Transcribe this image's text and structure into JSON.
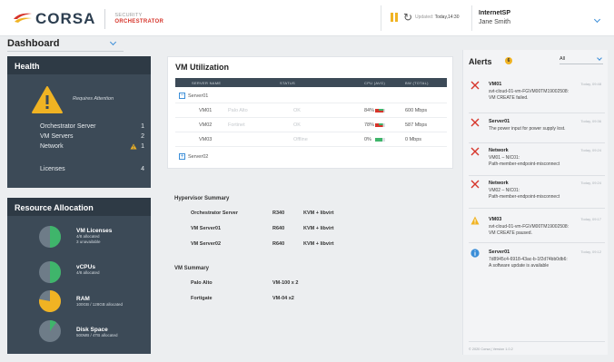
{
  "header": {
    "brand": "CORSA",
    "product_line1": "SECURITY",
    "product_line2": "ORCHESTRATOR",
    "updated_label": "Updated:",
    "updated_value": "Today,14:30",
    "tenant": "InternetSP",
    "user": "Jane Smith"
  },
  "dashboard": {
    "label": "Dashboard"
  },
  "health": {
    "title": "Health",
    "status": "Requires Attention",
    "rows": [
      {
        "label": "Orchestrator Server",
        "value": "1",
        "warn": false
      },
      {
        "label": "VM Servers",
        "value": "2",
        "warn": false
      },
      {
        "label": "Network",
        "value": "1",
        "warn": true
      },
      {
        "label": "Licenses",
        "value": "4",
        "warn": false
      }
    ]
  },
  "resource": {
    "title": "Resource Allocation",
    "items": [
      {
        "name": "VM Licenses",
        "sub1": "4/8 allocated",
        "sub2": "3 unavailable",
        "fraction": 0.5,
        "color": "#3fb56b"
      },
      {
        "name": "vCPUs",
        "sub1": "4/8 allocated",
        "sub2": "",
        "fraction": 0.5,
        "color": "#3fb56b"
      },
      {
        "name": "RAM",
        "sub1": "100GB / 128GB allocated",
        "sub2": "",
        "fraction": 0.78,
        "color": "#f0b323"
      },
      {
        "name": "Disk Space",
        "sub1": "500MB / 4TB allocated",
        "sub2": "",
        "fraction": 0.1,
        "color": "#3fb56b"
      }
    ]
  },
  "vm_util": {
    "title": "VM Utilization",
    "columns": [
      "SERVER NAME",
      "STATUS",
      "CPU (AVG)",
      "BW (TOTAL)"
    ],
    "server1": "Server01",
    "server2": "Server02",
    "rows": [
      {
        "vm": "VM01",
        "vendor": "Palo Alto",
        "status": "OK",
        "cpu": "84%",
        "bw": "600 Mbps"
      },
      {
        "vm": "VM02",
        "vendor": "Fortinet",
        "status": "OK",
        "cpu": "78%",
        "bw": "587 Mbps"
      },
      {
        "vm": "VM03",
        "vendor": "",
        "status": "Offline",
        "cpu": "0%",
        "bw": "0   Mbps"
      }
    ]
  },
  "hypervisor": {
    "title": "Hypervisor Summary",
    "rows": [
      {
        "name": "Orchestrator Server",
        "model": "R340",
        "type": "KVM + libvirt"
      },
      {
        "name": "VM Server01",
        "model": "R640",
        "type": "KVM + libvirt"
      },
      {
        "name": "VM Server02",
        "model": "R640",
        "type": "KVM + libvirt"
      }
    ]
  },
  "vm_summary": {
    "title": "VM Summary",
    "rows": [
      {
        "name": "Palo Alto",
        "count": "VM-100 x 2"
      },
      {
        "name": "Fortigate",
        "count": "VM-04 x2"
      }
    ]
  },
  "alerts": {
    "title": "Alerts",
    "count": "6",
    "filter": "All",
    "items": [
      {
        "type": "error",
        "name": "VM01",
        "time": "Today, 09:48",
        "l1": "svt-cloud-01-vm-FGVM00TM19002508:",
        "l2": "VM CREATE failed."
      },
      {
        "type": "error",
        "name": "Server01",
        "time": "Today, 09:36",
        "l1": "The power input for power supply lost.",
        "l2": ""
      },
      {
        "type": "error",
        "name": "Network",
        "time": "Today, 09:24",
        "l1": "VM01 – NIC01:",
        "l2": "Path-member-endpoint-misconnect"
      },
      {
        "type": "error",
        "name": "Network",
        "time": "Today, 09:24",
        "l1": "VM02 – NIC01:",
        "l2": "Path-member-endpoint-misconnect"
      },
      {
        "type": "warn",
        "name": "VM03",
        "time": "Today, 09:17",
        "l1": "svt-cloud-01-vm-FGVM00TM19002508:",
        "l2": "VM CREATE paused."
      },
      {
        "type": "info",
        "name": "Server01",
        "time": "Today, 09:12",
        "l1": "7d8945c4-6918-43ac-b-1f2d74bb0db6:",
        "l2": "A software update is available"
      }
    ],
    "footer": "© 2020 Corsa  |  Version 1.0.2"
  },
  "colors": {
    "accent": "#3b8ed8",
    "warn": "#f0b323",
    "error": "#d6342a",
    "ok": "#3fb56b",
    "panel": "#3c4a57"
  }
}
